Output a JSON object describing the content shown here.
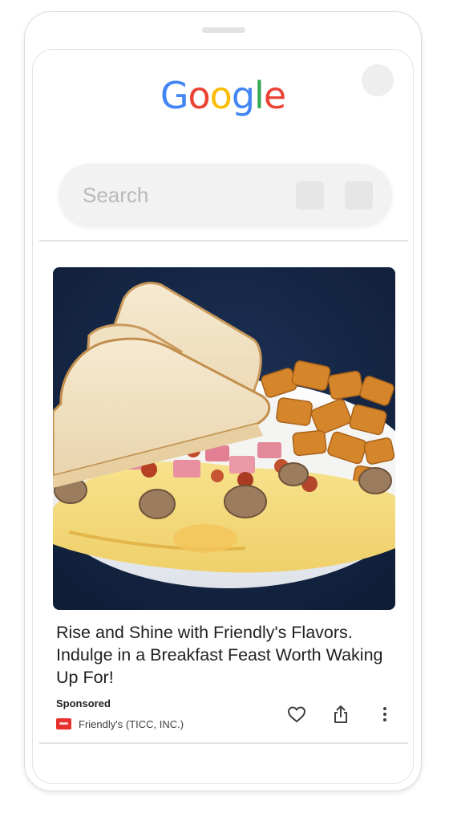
{
  "search": {
    "logo_letters": [
      "G",
      "o",
      "o",
      "g",
      "l",
      "e"
    ],
    "logo_colors": [
      "#4285F4",
      "#EA4335",
      "#FBBC05",
      "#4285F4",
      "#34A853",
      "#EA4335"
    ],
    "placeholder": "Search"
  },
  "ad": {
    "image_description_icon": "breakfast-plate-image",
    "headline": "Rise and Shine with Friendly's Flavors. Indulge in a Breakfast Feast Worth Waking Up For!",
    "sponsored_label": "Sponsored",
    "advertiser": "Friendly's (TICC, INC.)",
    "advertiser_logo_color": "#E8312F",
    "actions": [
      "heart-icon",
      "share-icon",
      "more-vert-icon"
    ]
  }
}
